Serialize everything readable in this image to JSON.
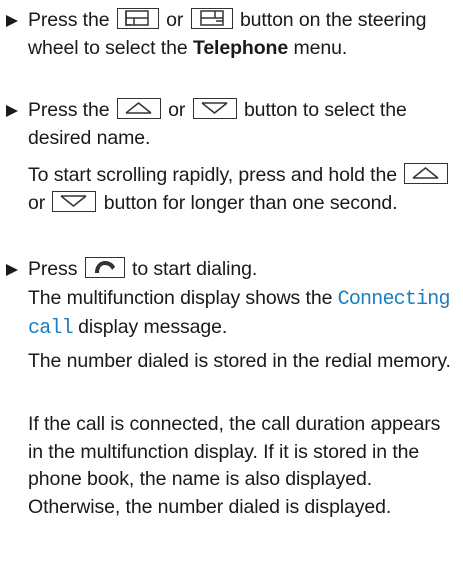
{
  "steps": [
    {
      "type": "bullet",
      "part1": "Press the",
      "or": "or",
      "part2": "button on the steering wheel to select the",
      "bold": "Telephone",
      "part3": "menu.",
      "icons": [
        "menu-left-icon",
        "menu-right-icon"
      ]
    },
    {
      "type": "bullet",
      "part1": "Press the",
      "or": "or",
      "part2": "button to select the desired name.",
      "icons": [
        "arrow-up-icon",
        "arrow-down-icon"
      ]
    },
    {
      "type": "text",
      "part1": "To start scrolling rapidly, press and hold the",
      "or": "or",
      "part2": "button for longer than one second.",
      "icons": [
        "arrow-up-icon",
        "arrow-down-icon"
      ]
    },
    {
      "type": "bullet",
      "part1": "Press",
      "part2": "to start dialing.",
      "icons": [
        "phone-dial-icon"
      ]
    },
    {
      "type": "text",
      "part1": "The multifunction display shows the",
      "display_message": "Connecting call",
      "part2": "display message."
    },
    {
      "type": "text",
      "text": "The number dialed is stored in the redial memory."
    },
    {
      "type": "text",
      "text": "If the call is connected, the call duration appears in the multifunction display. If it is stored in the phone book, the name is also displayed. Otherwise, the number dialed is displayed."
    }
  ],
  "colors": {
    "text": "#1a1a1a",
    "display_message": "#1a7fc0"
  }
}
